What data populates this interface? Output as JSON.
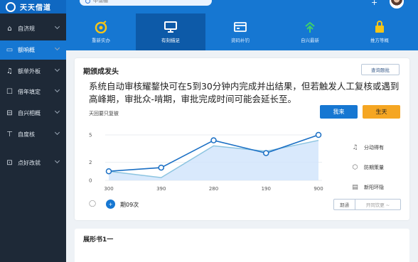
{
  "app": {
    "brand": "天天借道",
    "search_placeholder": "中请输",
    "plus": "+"
  },
  "sidebar": {
    "items": [
      {
        "label": "自济规",
        "icon": "home-icon"
      },
      {
        "label": "额响概",
        "icon": "wallet-icon"
      },
      {
        "label": "额单外板",
        "icon": "bell-icon"
      },
      {
        "label": "借年填定",
        "icon": "square-icon"
      },
      {
        "label": "自兴相概",
        "icon": "chat-icon"
      },
      {
        "label": "自度核",
        "icon": "filter-icon"
      },
      {
        "label": "点好改就",
        "icon": "document-icon"
      }
    ]
  },
  "tabs": [
    {
      "label": "重新实办",
      "icon": "clock-icon"
    },
    {
      "label": "有刻描足",
      "icon": "monitor-icon"
    },
    {
      "label": "资码补钓",
      "icon": "card-icon"
    },
    {
      "label": "自兴最新",
      "icon": "tree-icon"
    },
    {
      "label": "推方等概",
      "icon": "lock-icon"
    }
  ],
  "card": {
    "title": "期颁成发头",
    "action": "查询题批",
    "message": "系统自动审核耀鍪快可在5到30分钟内完成并出结果，但若触发人工复核或遇到高峰期，审批众-啃期，审批完成时间可能会延长至。",
    "sub": "天回要只复彼",
    "primary_button": "我来",
    "secondary_button": "生天"
  },
  "legend": [
    {
      "label": "分动得有",
      "icon": "bell-icon"
    },
    {
      "label": "防期策量",
      "icon": "shield-icon"
    },
    {
      "label": "新阳环隐",
      "icon": "doc-icon"
    }
  ],
  "footer": {
    "toggle_label": "期09次",
    "seg_left": "期通",
    "seg_right": "开同饮更 ~"
  },
  "card2": {
    "title": "展形书1一"
  },
  "chart_data": {
    "type": "line",
    "categories": [
      "300",
      "390",
      "280",
      "190",
      "900"
    ],
    "ytick_labels": [
      "0",
      "2",
      "5"
    ],
    "ylim": [
      0,
      5
    ],
    "series": [
      {
        "values": [
          1.0,
          1.4,
          4.4,
          3.0,
          5.0
        ]
      },
      {
        "values": [
          1.0,
          0.3,
          3.8,
          3.2,
          4.4
        ]
      }
    ],
    "colors": {
      "line1": "#1a6fc4",
      "line2": "#8cc4e0",
      "area": "#cfe3fb"
    }
  }
}
